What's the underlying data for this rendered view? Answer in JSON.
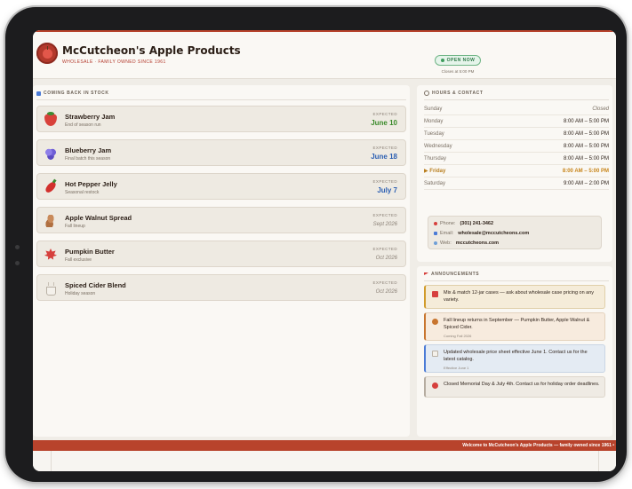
{
  "header": {
    "brand_name": "McCutcheon's Apple Products",
    "tagline": "WHOLESALE · FAMILY OWNED SINCE 1961",
    "status_badge": "OPEN NOW",
    "closes": "Closes at 5:00 PM"
  },
  "restock": {
    "title": "COMING BACK IN STOCK",
    "expected_label": "EXPECTED",
    "items": [
      {
        "name": "Strawberry Jam",
        "note": "End of season run",
        "date": "June 10",
        "icon": "strawberry-icon"
      },
      {
        "name": "Blueberry Jam",
        "note": "Final batch this season",
        "date": "June 18",
        "icon": "blueberry-icon"
      },
      {
        "name": "Hot Pepper Jelly",
        "note": "Seasonal restock",
        "date": "July 7",
        "icon": "pepper-icon"
      },
      {
        "name": "Apple Walnut Spread",
        "note": "Fall lineup",
        "date": "Sept 2026",
        "icon": "walnut-icon"
      },
      {
        "name": "Pumpkin Butter",
        "note": "Fall exclusive",
        "date": "Oct 2026",
        "icon": "maple-leaf-icon"
      },
      {
        "name": "Spiced Cider Blend",
        "note": "Holiday season",
        "date": "Oct 2026",
        "icon": "cider-cup-icon"
      }
    ]
  },
  "hours": {
    "title": "HOURS & CONTACT",
    "days": [
      {
        "day": "Sunday",
        "time": "Closed"
      },
      {
        "day": "Monday",
        "time": "8:00 AM – 5:00 PM"
      },
      {
        "day": "Tuesday",
        "time": "8:00 AM – 5:00 PM"
      },
      {
        "day": "Wednesday",
        "time": "8:00 AM – 5:00 PM"
      },
      {
        "day": "Thursday",
        "time": "8:00 AM – 5:00 PM"
      },
      {
        "day": "▶ Friday",
        "time": "8:00 AM – 5:00 PM"
      },
      {
        "day": "Saturday",
        "time": "9:00 AM – 2:00 PM"
      }
    ],
    "today": "Friday"
  },
  "contact": {
    "phone_label": "Phone:",
    "phone": "(301) 241-3462",
    "email_label": "Email:",
    "email": "wholesale@mccutcheons.com",
    "web_label": "Web:",
    "web": "mccutcheons.com"
  },
  "announcements": {
    "title": "ANNOUNCEMENTS",
    "items": [
      {
        "text": "Mix & match 12-jar cases — ask about wholesale case pricing on any variety.",
        "note": ""
      },
      {
        "text": "Fall lineup returns in September — Pumpkin Butter, Apple Walnut & Spiced Cider.",
        "note": "Coming Fall 2026"
      },
      {
        "text": "Updated wholesale price sheet effective June 1. Contact us for the latest catalog.",
        "note": "Effective June 1"
      },
      {
        "text": "Closed Memorial Day & July 4th. Contact us for holiday order deadlines.",
        "note": ""
      }
    ]
  },
  "ticker": {
    "text": "Welcome to McCutcheon's Apple Products — family owned since 1961 •"
  },
  "colors": {
    "brand_red": "#b8432c",
    "open_green": "#3e9c5d",
    "date_green": "#3a8a2a",
    "date_blue": "#2c5fb2",
    "today_amber": "#c8851a"
  }
}
